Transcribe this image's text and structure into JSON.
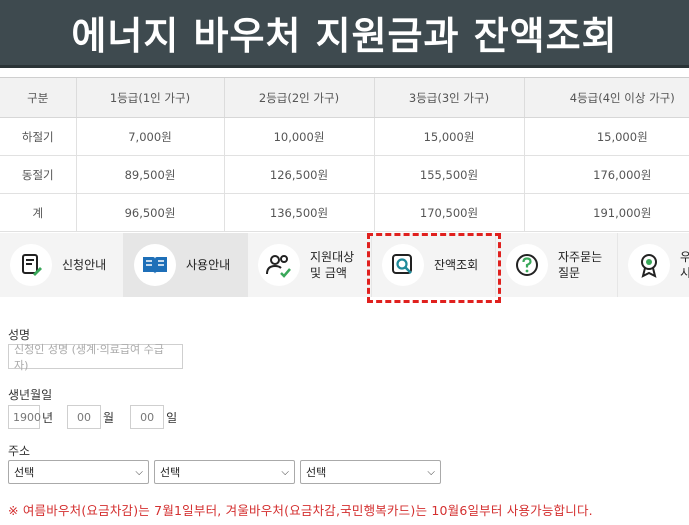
{
  "banner": {
    "title": "에너지 바우처 지원금과 잔액조회"
  },
  "table": {
    "headers": [
      "구분",
      "1등급(1인 가구)",
      "2등급(2인 가구)",
      "3등급(3인 가구)",
      "4등급(4인 이상 가구)"
    ],
    "rows": [
      [
        "하절기",
        "7,000원",
        "10,000원",
        "15,000원",
        "15,000원"
      ],
      [
        "동절기",
        "89,500원",
        "126,500원",
        "155,500원",
        "176,000원"
      ],
      [
        "계",
        "96,500원",
        "136,500원",
        "170,500원",
        "191,000원"
      ]
    ]
  },
  "tabs": [
    {
      "label": "신청안내",
      "icon": "document-pen-icon"
    },
    {
      "label": "사용안내",
      "icon": "open-book-icon"
    },
    {
      "label": "지원대상\n및 금액",
      "icon": "people-check-icon"
    },
    {
      "label": "잔액조회",
      "icon": "search-icon"
    },
    {
      "label": "자주묻는\n질문",
      "icon": "question-icon"
    },
    {
      "label": "우\n시",
      "icon": "award-icon"
    }
  ],
  "form": {
    "name_label": "성명",
    "name_placeholder": "신청인 성명 (생계·의료급여 수급자)",
    "dob_label": "생년월일",
    "dob_year": "1900",
    "dob_year_unit": "년",
    "dob_month": "00",
    "dob_month_unit": "월",
    "dob_day": "00",
    "dob_day_unit": "일",
    "address_label": "주소",
    "select_1": "선택",
    "select_2": "선택",
    "select_3": "선택"
  },
  "notice": "※ 여름바우처(요금차감)는 7월1일부터, 겨울바우처(요금차감,국민행복카드)는 10월6일부터 사용가능합니다.",
  "colors": {
    "banner_bg": "#3e4a4f",
    "accent_red": "#e0201e",
    "notice_red": "#d43030",
    "tab_bg": "#f4f4f4"
  }
}
